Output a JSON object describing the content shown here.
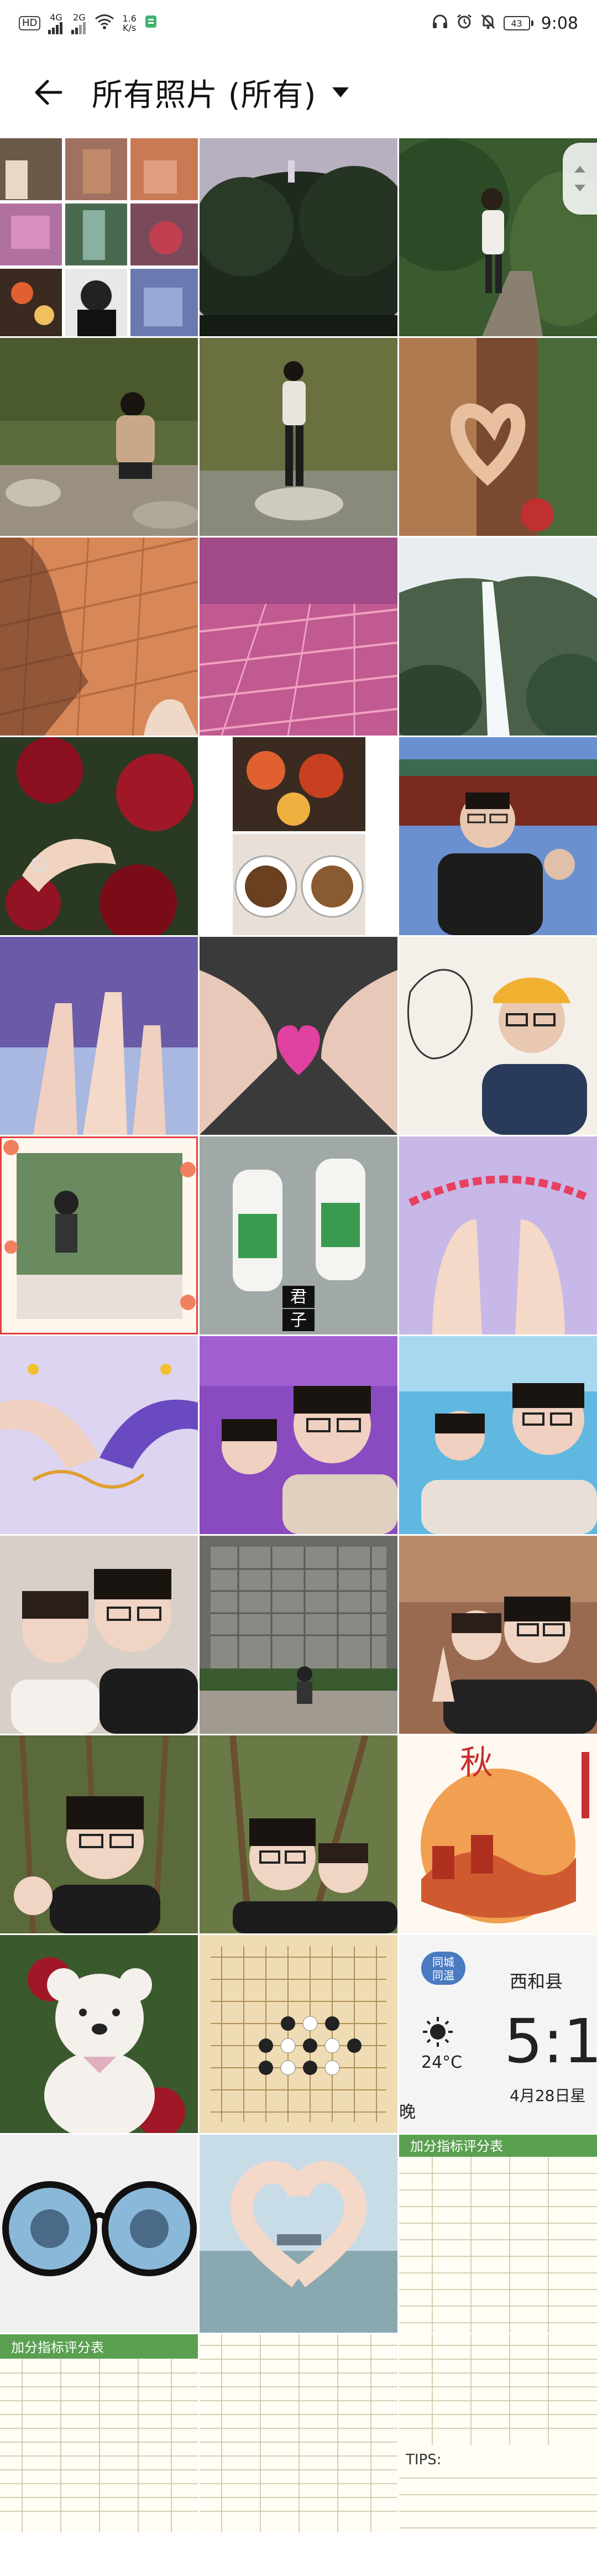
{
  "status_bar": {
    "hd_label": "HD",
    "signal_4g": "4G",
    "signal_2g": "2G",
    "speed_value": "1.6",
    "speed_unit": "K/s",
    "battery": "43",
    "time": "9:08"
  },
  "app_bar": {
    "title": "所有照片 (所有)"
  },
  "colors": {
    "background": "#ffffff",
    "text": "#111111"
  },
  "photos": [
    {
      "name": "photo-collage-1"
    },
    {
      "name": "photo-dark-trees"
    },
    {
      "name": "photo-person-on-path"
    },
    {
      "name": "photo-crouching-by-stream"
    },
    {
      "name": "photo-standing-by-stream"
    },
    {
      "name": "photo-heart-hands-rock"
    },
    {
      "name": "photo-shadow-brick-wall"
    },
    {
      "name": "photo-pink-brick-floor"
    },
    {
      "name": "photo-waterfall"
    },
    {
      "name": "photo-roses-hand"
    },
    {
      "name": "photo-food-collage"
    },
    {
      "name": "photo-selfie-temple"
    },
    {
      "name": "photo-finger-heart-purple"
    },
    {
      "name": "photo-heart-emoji-hands"
    },
    {
      "name": "photo-couple-drawing"
    },
    {
      "name": "photo-peach-frame"
    },
    {
      "name": "photo-yogurt-bottles"
    },
    {
      "name": "photo-hands-ribbon"
    },
    {
      "name": "photo-hands-sketch"
    },
    {
      "name": "photo-selfie-purple"
    },
    {
      "name": "photo-selfie-blue"
    },
    {
      "name": "photo-couple-selfie-1"
    },
    {
      "name": "photo-building-cyclist"
    },
    {
      "name": "photo-couple-street"
    },
    {
      "name": "photo-forest-selfie-1"
    },
    {
      "name": "photo-forest-selfie-2"
    },
    {
      "name": "photo-autumn-illustration"
    },
    {
      "name": "photo-teddy-bear"
    },
    {
      "name": "photo-gomoku-board"
    },
    {
      "name": "photo-weather-widget"
    },
    {
      "name": "photo-glasses-reflection"
    },
    {
      "name": "photo-heart-hands-lake"
    },
    {
      "name": "photo-score-table-right"
    },
    {
      "name": "photo-score-table-left"
    },
    {
      "name": "photo-score-table-middle"
    },
    {
      "name": "photo-score-table-right-2"
    }
  ],
  "photo_texts": {
    "jun_zi_1": "君",
    "jun_zi_2": "子",
    "weather_city": "西和县",
    "weather_temp": "24°C",
    "weather_time": "5:1",
    "weather_date": "4月28日星",
    "weather_evening": "晚",
    "weather_badge_1": "同城",
    "weather_badge_2": "同温",
    "score_title": "加分指标评分表",
    "tips_label": "TIPS:"
  }
}
